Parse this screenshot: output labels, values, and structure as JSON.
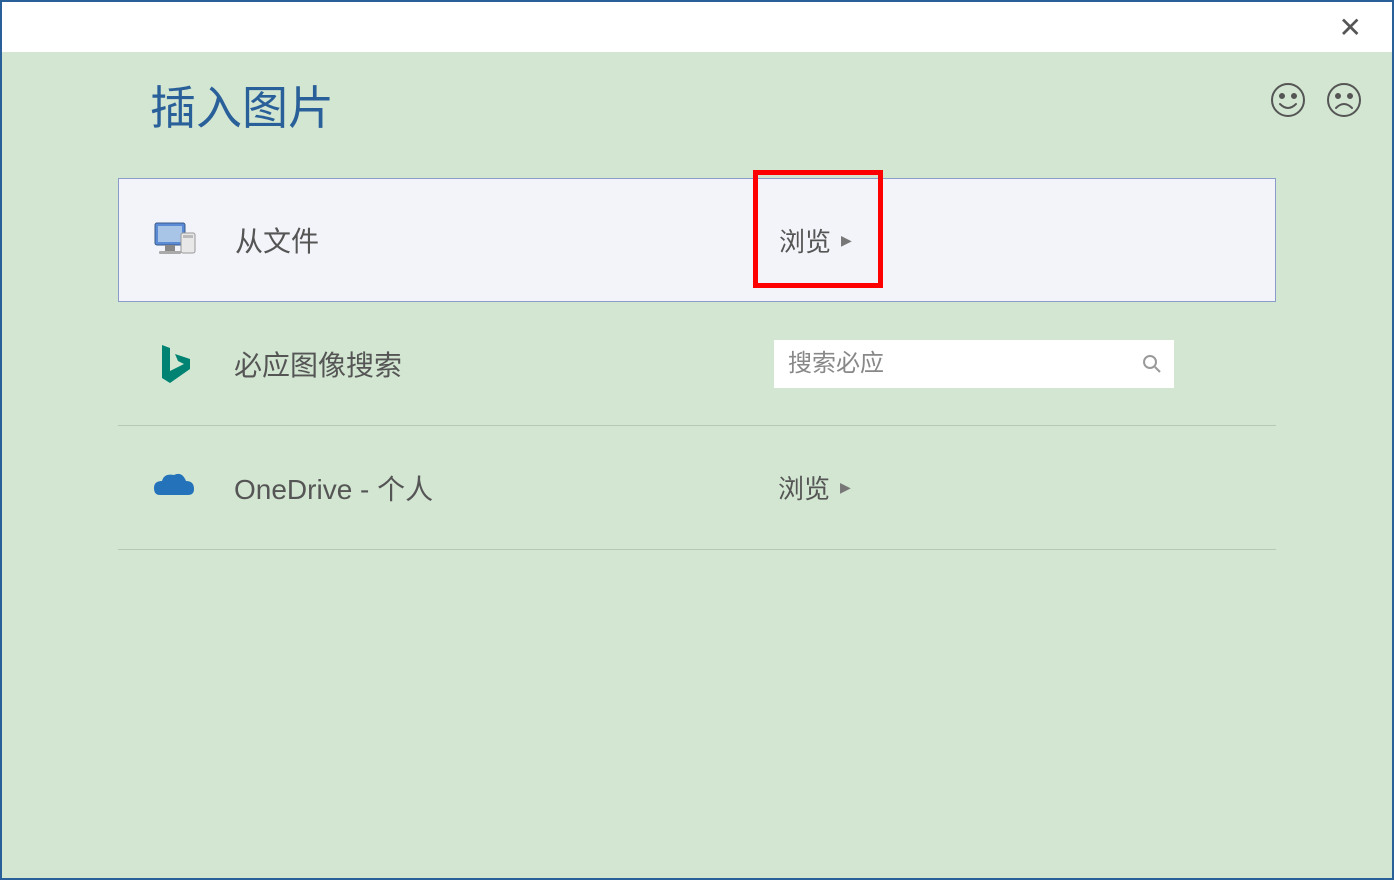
{
  "dialog": {
    "title": "插入图片"
  },
  "sources": {
    "file": {
      "label": "从文件",
      "action": "浏览"
    },
    "bing": {
      "label": "必应图像搜索",
      "placeholder": "搜索必应"
    },
    "onedrive": {
      "label": "OneDrive - 个人",
      "action": "浏览"
    }
  }
}
